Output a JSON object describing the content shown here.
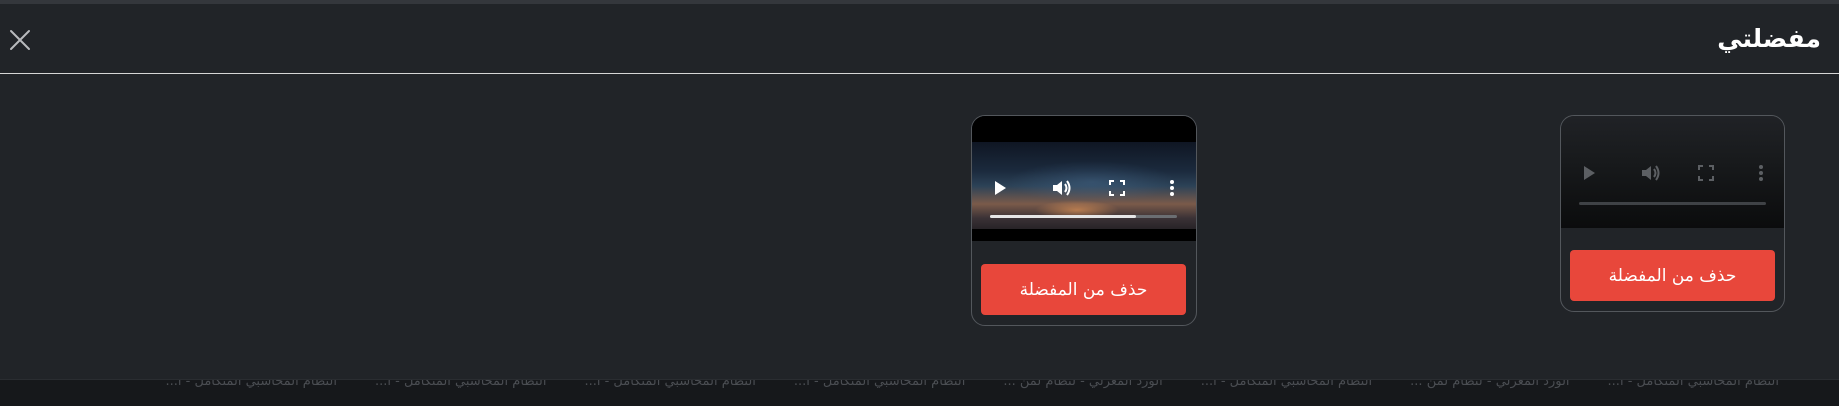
{
  "modal": {
    "title": "مفضلتي",
    "close_icon": "close-icon"
  },
  "favorites": [
    {
      "remove_label": "حذف من المفضلة",
      "progress": 0,
      "controls": [
        "play-icon",
        "volume-icon",
        "fullscreen-icon",
        "more-options-icon"
      ]
    },
    {
      "remove_label": "حذف من المفضلة",
      "progress": 0.78,
      "controls": [
        "play-icon",
        "volume-icon",
        "fullscreen-icon",
        "more-options-icon"
      ]
    }
  ],
  "background_titles": [
    "النظام المحاسبي المتكامل - ا...",
    "النظام المحاسبي المتكامل - ا...",
    "النظام المحاسبي المتكامل - ا...",
    "النظام المحاسبي المتكامل - ا...",
    "الورد المعزلي - لنظام لمن ...",
    "النظام المحاسبي المتكامل - ا...",
    "الورد المعزلي - لنظام لمن ...",
    "النظام المحاسبي المتكامل - ا..."
  ],
  "colors": {
    "accent_red": "#e8473b",
    "modal_bg": "#212428",
    "text": "#ffffff"
  }
}
